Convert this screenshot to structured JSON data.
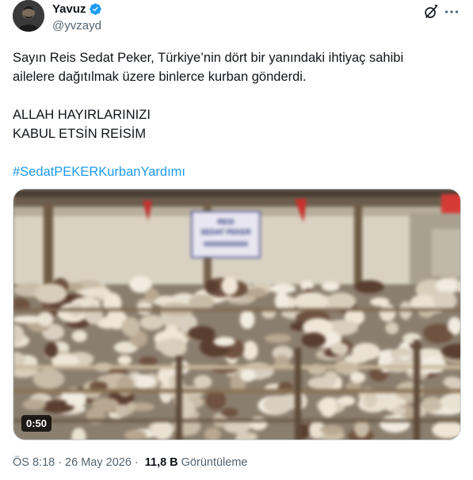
{
  "author": {
    "display_name": "Yavuz",
    "handle": "@yvzayd"
  },
  "tweet": {
    "line1": "Sayın Reis Sedat Peker, Türkiye’nin dört bir yanındaki ihtiyaç sahibi",
    "line2": "ailelere dağıtılmak üzere binlerce kurban gönderdi.",
    "line3": "ALLAH HAYIRLARINIZI",
    "line4": "KABUL ETSİN REİSİM",
    "hashtag": "#SedatPEKERKurbanYardımı"
  },
  "media": {
    "banner_line1": "REIS",
    "banner_line2": "SEDAT PEKER",
    "duration": "0:50"
  },
  "meta": {
    "time": "ÖS 8:18",
    "separator": "·",
    "date": "26 May 2026",
    "views_count": "11,8 B",
    "views_label": "Görüntüleme"
  },
  "colors": {
    "text": "#0f1419",
    "secondary": "#536471",
    "link": "#1d9bf0",
    "verified": "#1d9bf0"
  },
  "icons": [
    "verified-badge-icon",
    "grok-icon",
    "more-icon"
  ]
}
